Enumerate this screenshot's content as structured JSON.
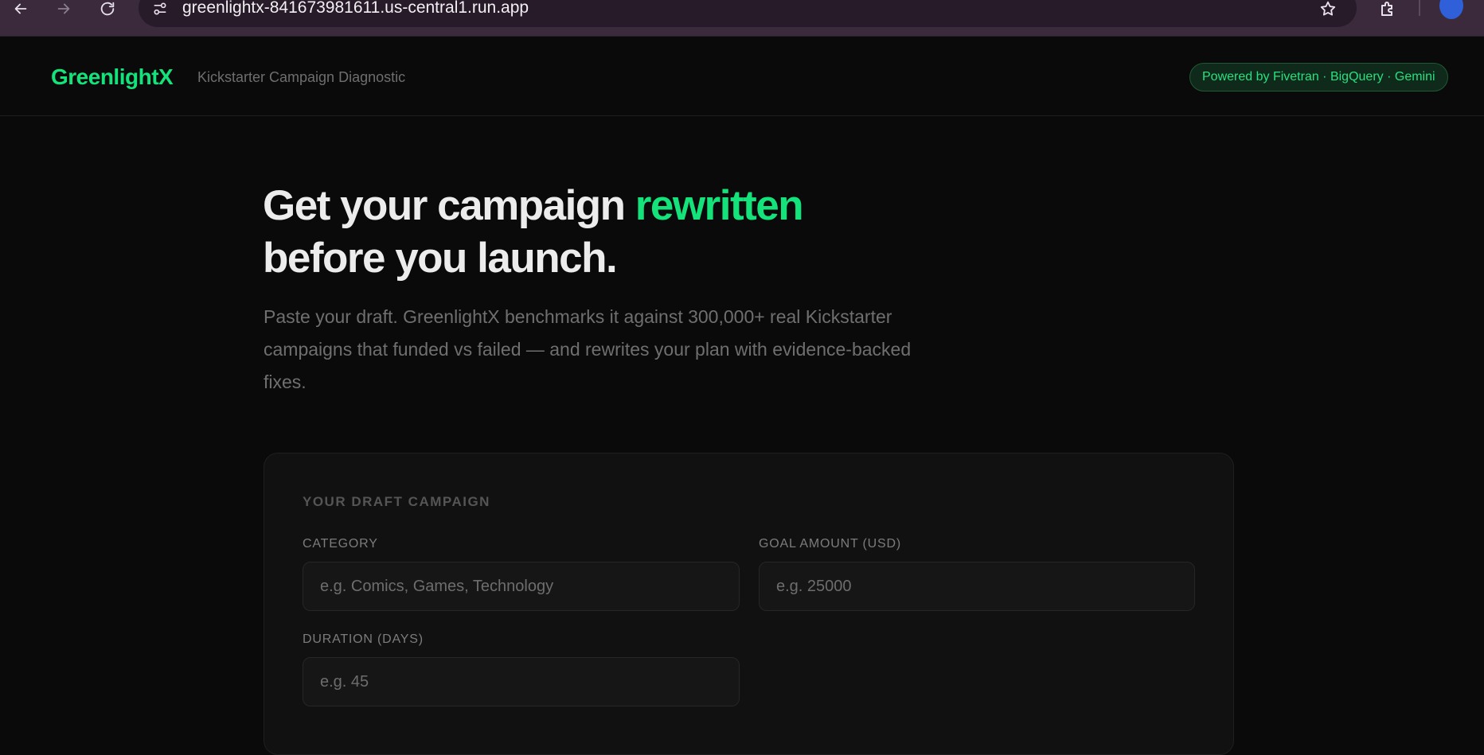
{
  "browser": {
    "url": "greenlightx-841673981611.us-central1.run.app",
    "icons": [
      "back-arrow-icon",
      "forward-arrow-icon",
      "reload-icon",
      "site-info-icon",
      "star-icon",
      "extensions-icon",
      "profile-avatar"
    ]
  },
  "header": {
    "logo": "GreenlightX",
    "subtitle": "Kickstarter Campaign Diagnostic",
    "powered_by": "Powered by Fivetran · BigQuery · Gemini"
  },
  "hero": {
    "title_part1": "Get your campaign ",
    "title_accent": "rewritten",
    "title_part2": "before you launch.",
    "description": "Paste your draft. GreenlightX benchmarks it against 300,000+ real Kickstarter campaigns that funded vs failed — and rewrites your plan with evidence-backed fixes."
  },
  "form": {
    "section_title": "YOUR DRAFT CAMPAIGN",
    "category": {
      "label": "CATEGORY",
      "value": "",
      "placeholder": "e.g. Comics, Games, Technology"
    },
    "goal": {
      "label": "GOAL AMOUNT (USD)",
      "value": "",
      "placeholder": "e.g. 25000"
    },
    "duration": {
      "label": "DURATION (DAYS)",
      "value": "",
      "placeholder": "e.g. 45"
    }
  },
  "colors": {
    "accent": "#14e37b",
    "background": "#0a0a0a",
    "card": "#111111",
    "chrome": "#3a2a3c"
  }
}
